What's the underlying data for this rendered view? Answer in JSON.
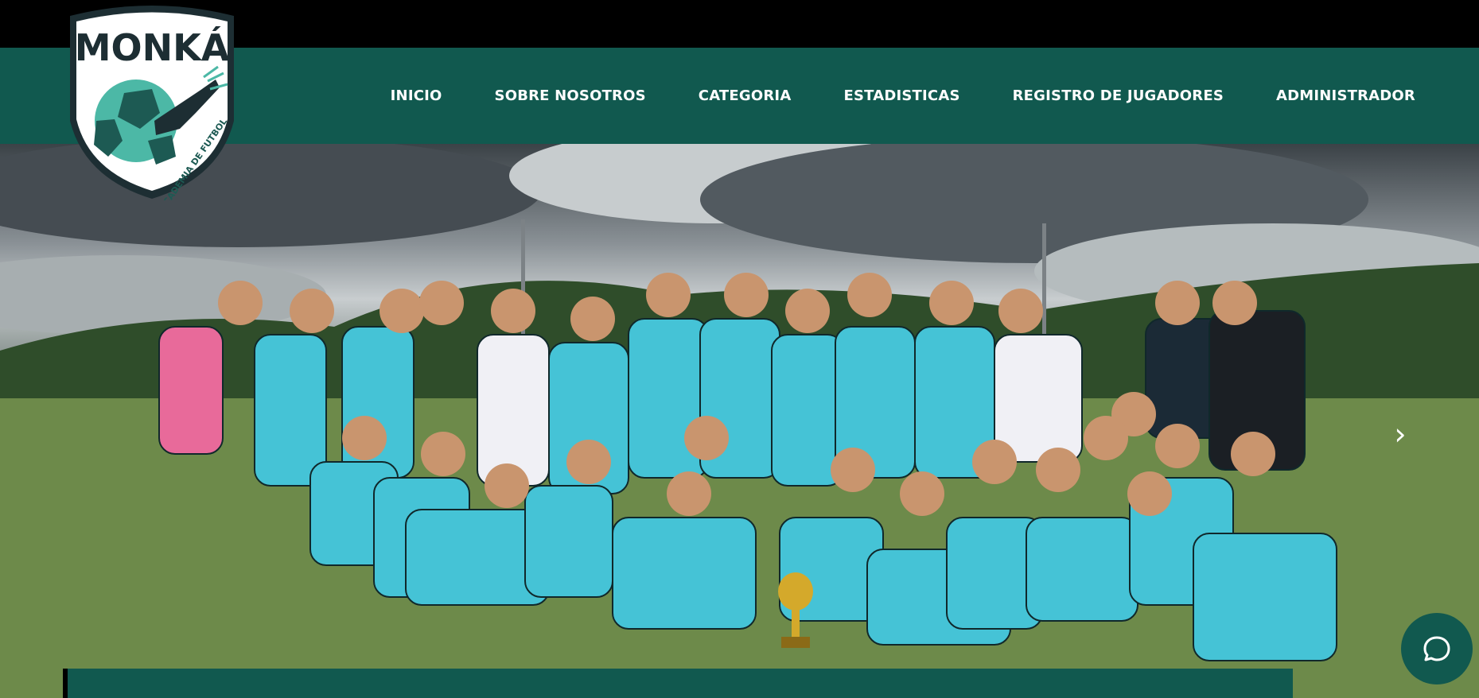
{
  "brand": {
    "name": "MONKÁ",
    "tagline": "ACADEMIA DE FUTBOL"
  },
  "nav": {
    "items": [
      {
        "label": "INICIO"
      },
      {
        "label": "SOBRE NOSOTROS"
      },
      {
        "label": "CATEGORIA"
      },
      {
        "label": "ESTADISTICAS"
      },
      {
        "label": "REGISTRO DE JUGADORES"
      },
      {
        "label": "ADMINISTRADOR"
      }
    ]
  },
  "hero": {
    "next_arrow": "›",
    "description_icon": "team-photo"
  },
  "colors": {
    "brand_green": "#11594f",
    "jersey_cyan": "#45c3d6",
    "accent_pink": "#e86a9a"
  },
  "icons": {
    "chat": "chat-bubble-icon"
  }
}
